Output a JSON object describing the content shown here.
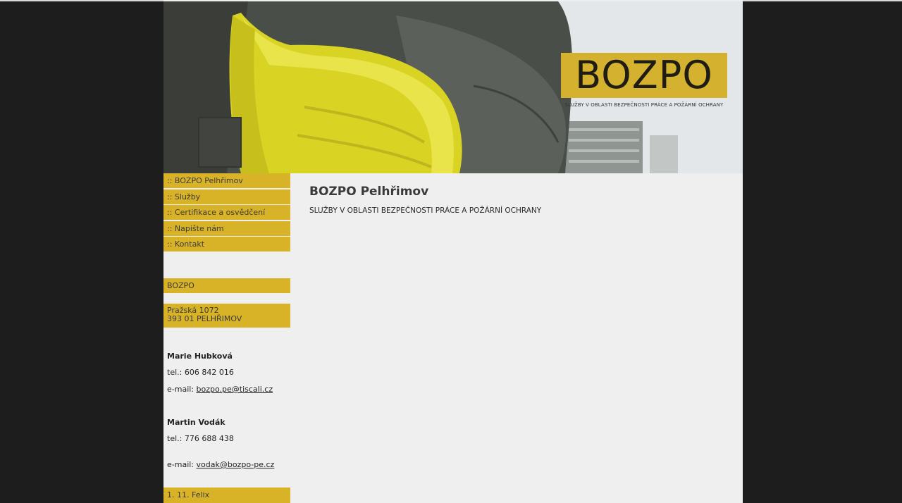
{
  "header": {
    "logo_text": "BOZPO",
    "tagline": "SLUŽBY V OBLASTI BEZPEČNOSTI PRÁCE A POŽÁRNÍ OCHRANY"
  },
  "nav": {
    "items": [
      {
        "label": ":: BOZPO Pelhřimov"
      },
      {
        "label": ":: Služby"
      },
      {
        "label": ":: Certifikace a osvědčení"
      },
      {
        "label": ":: Napište nám"
      },
      {
        "label": ":: Kontakt"
      }
    ]
  },
  "sidebar": {
    "company": "BOZPO",
    "address_line1": "Pražská 1072",
    "address_line2": "393 01 PELHŘIMOV",
    "contacts": [
      {
        "name": "Marie Hubková",
        "tel_label": "tel.: 606 842 016",
        "email_label": "e-mail: ",
        "email": "bozpo.pe@tiscali.cz"
      },
      {
        "name": "Martin Vodák",
        "tel_label": "tel.: 776 688 438",
        "email_label": "e-mail: ",
        "email": "vodak@bozpo-pe.cz"
      }
    ],
    "nameday": "1. 11. Felix"
  },
  "main": {
    "title": "BOZPO Pelhřimov",
    "subtitle": "SLUŽBY V OBLASTI BEZPEČNOSTI PRÁCE A POŽÁRNÍ OCHRANY"
  },
  "colors": {
    "accent": "#d9b327",
    "background": "#1d1d1d",
    "page": "#efefef"
  }
}
